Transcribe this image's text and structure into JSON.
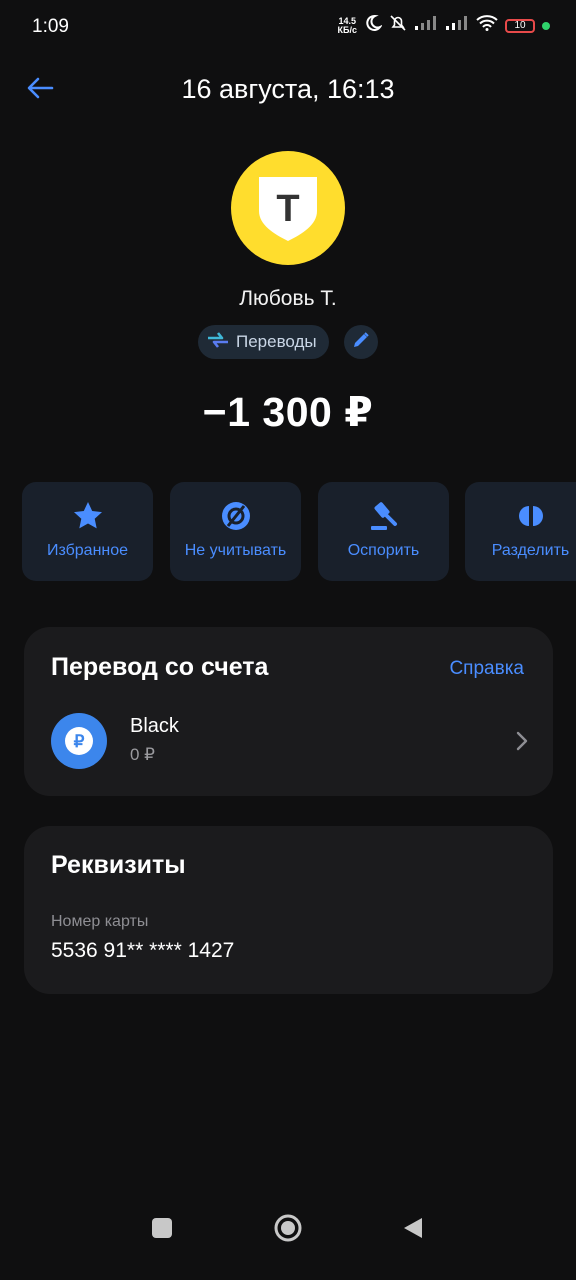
{
  "status_bar": {
    "time": "1:09",
    "net_speed_top": "14.5",
    "net_speed_bottom": "КБ/с",
    "battery": "10"
  },
  "header": {
    "title": "16 августа, 16:13"
  },
  "logo": {
    "letter": "Т",
    "color": "#ffdd2d"
  },
  "recipient": {
    "name": "Любовь Т."
  },
  "category": {
    "label": "Переводы"
  },
  "amount": "−1 300 ₽",
  "actions": [
    {
      "label": "Избранное",
      "icon": "star-icon"
    },
    {
      "label": "Не учитывать",
      "icon": "exclude-icon"
    },
    {
      "label": "Оспорить",
      "icon": "gavel-icon"
    },
    {
      "label": "Разделить",
      "icon": "split-icon"
    }
  ],
  "transfer_card": {
    "title": "Перевод со счета",
    "help_link": "Справка",
    "account_name": "Black",
    "account_balance": "0 ₽",
    "account_icon": "ruble-icon"
  },
  "details_card": {
    "title": "Реквизиты",
    "card_number_label": "Номер карты",
    "card_number": "5536 91** **** 1427"
  },
  "colors": {
    "accent": "#4a8dff",
    "background": "#0f0f10",
    "card": "#1b1b1d",
    "action_bg": "#19202b"
  }
}
